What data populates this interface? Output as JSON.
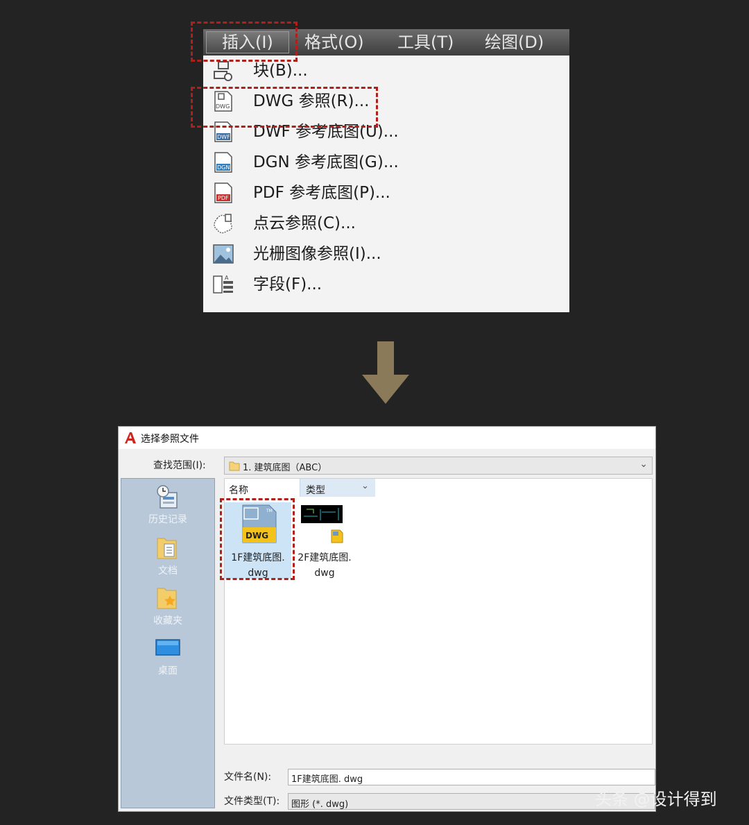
{
  "menubar": {
    "items": [
      "插入(I)",
      "格式(O)",
      "工具(T)",
      "绘图(D)"
    ]
  },
  "dropdown": {
    "items": [
      {
        "label": "块(B)...",
        "icon": "block-icon"
      },
      {
        "label": "DWG 参照(R)...",
        "icon": "dwg-file-icon"
      },
      {
        "label": "DWF 参考底图(U)...",
        "icon": "dwf-file-icon"
      },
      {
        "label": "DGN 参考底图(G)...",
        "icon": "dgn-file-icon"
      },
      {
        "label": "PDF 参考底图(P)...",
        "icon": "pdf-file-icon"
      },
      {
        "label": "点云参照(C)...",
        "icon": "point-cloud-icon"
      },
      {
        "label": "光栅图像参照(I)...",
        "icon": "raster-image-icon"
      },
      {
        "label": "字段(F)...",
        "icon": "field-icon"
      }
    ]
  },
  "dialog": {
    "title": "选择参照文件",
    "lookin_label": "查找范围(I):",
    "lookin_value": "1. 建筑底图（ABC）",
    "places": [
      "历史记录",
      "文档",
      "收藏夹",
      "桌面"
    ],
    "columns": {
      "name": "名称",
      "type": "类型"
    },
    "files": [
      {
        "line1": "1F建筑底图.",
        "line2": "dwg",
        "selected": true
      },
      {
        "line1": "2F建筑底图.",
        "line2": "dwg",
        "selected": false
      }
    ],
    "filename_label": "文件名(N):",
    "filename_value": "1F建筑底图. dwg",
    "filetype_label": "文件类型(T):",
    "filetype_value": "图形 (*. dwg)"
  },
  "watermark": "头条 @设计得到",
  "colors": {
    "highlight_box": "#b0201a",
    "arrow": "#8a7a5a",
    "background": "#232323"
  }
}
